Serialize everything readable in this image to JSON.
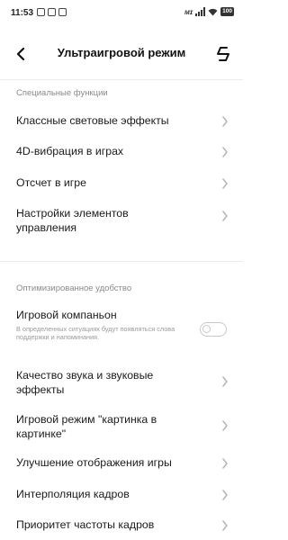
{
  "status_bar": {
    "time": "11:53",
    "network": "ᴍɪ",
    "battery": "100"
  },
  "header": {
    "title": "Ультраигровой режим"
  },
  "sections": [
    {
      "label": "Специальные функции",
      "items": [
        {
          "label": "Классные световые эффекты"
        },
        {
          "label": "4D-вибрация в играх"
        },
        {
          "label": "Отсчет в игре"
        },
        {
          "label": "Настройки элементов управления"
        }
      ]
    },
    {
      "label": "Оптимизированное удобство",
      "items": [
        {
          "label": "Игровой компаньон",
          "description": "В определенных ситуациях будут появляться слова поддержки и напоминания.",
          "toggle": false
        },
        {
          "label": "Качество звука и звуковые эффекты"
        },
        {
          "label": "Игровой режим \"картинка в картинке\""
        },
        {
          "label": "Улучшение отображения игры"
        },
        {
          "label": "Интерполяция кадров"
        },
        {
          "label": "Приоритет частоты кадров"
        }
      ]
    }
  ]
}
